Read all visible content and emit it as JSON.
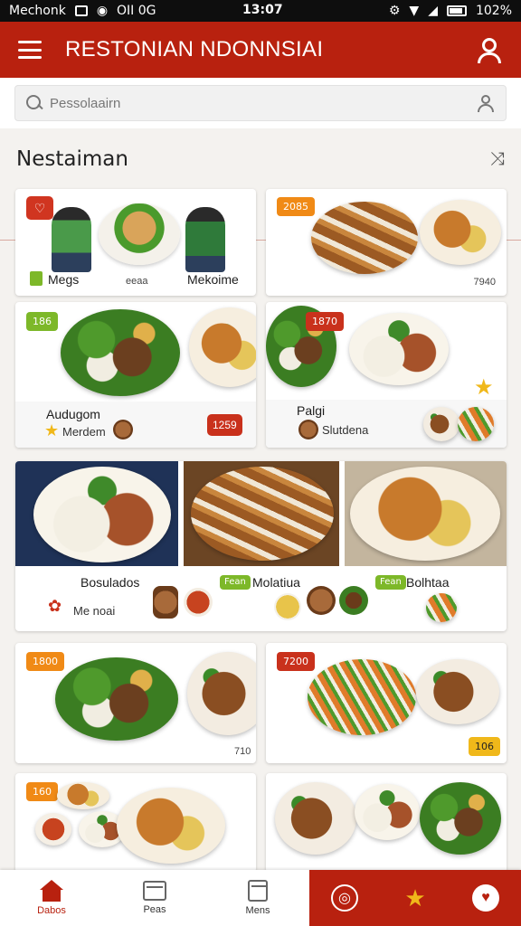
{
  "status_bar": {
    "carrier": "Mechonk",
    "time": "13:07",
    "indicators": "OII 0G",
    "battery": "102%"
  },
  "app_bar": {
    "title": "RESTONIAN NDONNSIAI",
    "menu_icon": "hamburger-icon",
    "profile_icon": "profile-icon"
  },
  "search": {
    "placeholder": "Pessolaairn",
    "search_icon": "search-icon",
    "user_icon": "user-icon"
  },
  "section": {
    "title": "Nestaiman",
    "action_icon": "shuffle-icon"
  },
  "cards": {
    "c1": {
      "left_label": "Megs",
      "center_label": "eeaa",
      "right_label": "Mekoime"
    },
    "c2": {
      "badge": "2085",
      "price": "7940"
    },
    "c3": {
      "badge": "186",
      "title": "Audugom",
      "sub": "Merdem",
      "price": "1259"
    },
    "c4": {
      "badge": "1870",
      "title": "Palgi",
      "sub": "Slutdena"
    },
    "wide": {
      "title": "Bosulados",
      "sub": "Me noai",
      "tag1": "Fean",
      "label1": "Molatiua",
      "tag2": "Fean",
      "label2": "Bolhtaa"
    },
    "c5": {
      "badge": "1800",
      "price": "710"
    },
    "c6": {
      "badge": "7200",
      "price": "106"
    },
    "c7": {
      "badge": "160"
    },
    "c8": {}
  },
  "bottom_nav": {
    "home": "Dabos",
    "orders": "Peas",
    "menu": "Mens"
  },
  "colors": {
    "brand": "#b8210f",
    "accent_orange": "#f08a16",
    "accent_green": "#7db829"
  }
}
